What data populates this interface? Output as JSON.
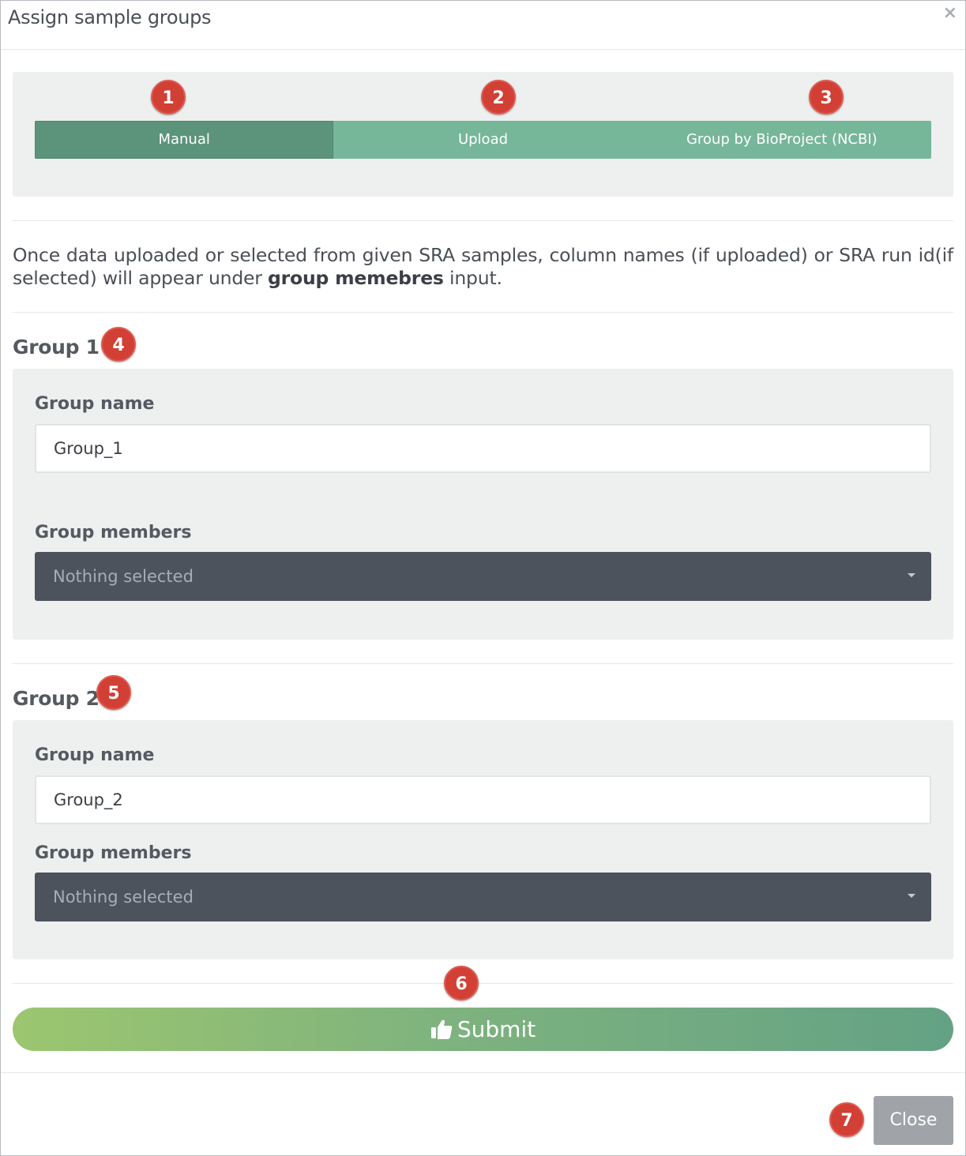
{
  "modal": {
    "title": "Assign sample groups",
    "close_icon_glyph": "×"
  },
  "markers": [
    "1",
    "2",
    "3",
    "4",
    "5",
    "6",
    "7"
  ],
  "tabs": [
    {
      "label": "Manual",
      "active": true
    },
    {
      "label": "Upload",
      "active": false
    },
    {
      "label": "Group by BioProject (NCBI)",
      "active": false
    }
  ],
  "info": {
    "text_before": "Once data uploaded or selected from given SRA samples, column names (if uploaded) or SRA run id(if selected) will appear under ",
    "bold": "group memebres",
    "text_after": " input."
  },
  "groups": [
    {
      "title": "Group 1",
      "name_label": "Group name",
      "name_value": "Group_1",
      "members_label": "Group members",
      "members_value": "Nothing selected"
    },
    {
      "title": "Group 2",
      "name_label": "Group name",
      "name_value": "Group_2",
      "members_label": "Group members",
      "members_value": "Nothing selected"
    }
  ],
  "submit": {
    "label": "Submit",
    "icon": "thumbs-up-icon"
  },
  "footer": {
    "close_label": "Close"
  },
  "colors": {
    "marker": "#d23f34",
    "tab": "#76b699",
    "tab_active": "#5c937b",
    "select_bg": "#4d535d",
    "close_button": "#a0a4a8"
  }
}
